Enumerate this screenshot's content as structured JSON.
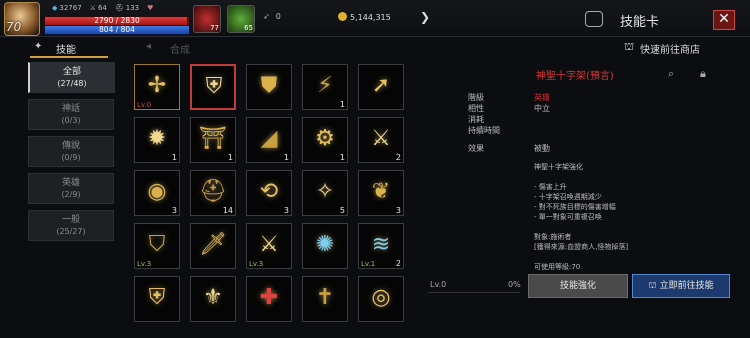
{
  "player": {
    "level": "70",
    "stat1": "32767",
    "stat2": "64",
    "stat3": "133",
    "hp": "2790 / 2830",
    "hp_fraction": 0.986,
    "mp": "804 / 804",
    "mp_fraction": 1.0,
    "buff1_count": "77",
    "buff2_count": "65"
  },
  "currency": {
    "feather": "0",
    "gold": "5,144,315"
  },
  "window": {
    "title": "技能卡",
    "close": "✕"
  },
  "tabs": [
    {
      "label": "技能"
    },
    {
      "label": "合成"
    }
  ],
  "shop_link": "快速前往商店",
  "sidebar": [
    {
      "label": "全部",
      "count": "(27/48)"
    },
    {
      "label": "神話",
      "count": "(0/3)"
    },
    {
      "label": "傳說",
      "count": "(0/9)"
    },
    {
      "label": "英雄",
      "count": "(2/9)"
    },
    {
      "label": "一般",
      "count": "(25/27)"
    }
  ],
  "skills": [
    {
      "icon": "holy-cross-icon",
      "lv": "Lv.0",
      "num": ""
    },
    {
      "icon": "shield-crest-icon",
      "lv": "",
      "num": ""
    },
    {
      "icon": "shield-icon",
      "lv": "",
      "num": ""
    },
    {
      "icon": "lightning-icon",
      "lv": "",
      "num": "1"
    },
    {
      "icon": "swoosh-arrow-icon",
      "lv": "",
      "num": ""
    },
    {
      "icon": "burst-icon",
      "lv": "",
      "num": "1"
    },
    {
      "icon": "altar-icon",
      "lv": "",
      "num": "1"
    },
    {
      "icon": "eye-wing-icon",
      "lv": "",
      "num": "1"
    },
    {
      "icon": "gear-ring-icon",
      "lv": "",
      "num": "1"
    },
    {
      "icon": "sword-slash-icon",
      "lv": "",
      "num": "2"
    },
    {
      "icon": "orb-icon",
      "lv": "",
      "num": "3"
    },
    {
      "icon": "helm-icon",
      "lv": "",
      "num": "14"
    },
    {
      "icon": "cycle-icon",
      "lv": "",
      "num": "3"
    },
    {
      "icon": "sparkle-icon",
      "lv": "",
      "num": "5"
    },
    {
      "icon": "winged-heart-icon",
      "lv": "",
      "num": "3"
    },
    {
      "icon": "knight-helm-icon",
      "lv": "Lv.3",
      "num": ""
    },
    {
      "icon": "sword-icon",
      "lv": "",
      "num": ""
    },
    {
      "icon": "great-sword-icon",
      "lv": "Lv.3",
      "num": ""
    },
    {
      "icon": "sun-ring-icon",
      "lv": "",
      "num": ""
    },
    {
      "icon": "whirlwind-icon",
      "lv": "Lv.1",
      "num": "2"
    },
    {
      "icon": "crest-icon",
      "lv": "",
      "num": ""
    },
    {
      "icon": "spire-icon",
      "lv": "",
      "num": ""
    },
    {
      "icon": "red-cross-icon",
      "lv": "",
      "num": ""
    },
    {
      "icon": "cross-icon",
      "lv": "",
      "num": ""
    },
    {
      "icon": "ring-icon",
      "lv": "",
      "num": ""
    }
  ],
  "detail": {
    "skill_name": "神聖十字架(預言)",
    "rows": [
      {
        "k": "階級",
        "v": "英雄"
      },
      {
        "k": "相性",
        "v": "中立"
      },
      {
        "k": "消耗",
        "v": ""
      },
      {
        "k": "持續時間",
        "v": ""
      }
    ],
    "effect_label": "效果",
    "effect_value": "被動",
    "desc": [
      "神聖十字架強化",
      "",
      "- 傷害上升",
      "- 十字架召喚週期減少",
      "- 對不死族目標的傷害增幅",
      "- 單一對象可重複召喚",
      "",
      "對象:施術者",
      "[獲得來源:血盟商人,怪物掉落]",
      "",
      "可使用等級:70"
    ],
    "level": "Lv.0",
    "percent": "0%",
    "enhance_button": "技能強化",
    "shop_button": "立即前往技能"
  }
}
